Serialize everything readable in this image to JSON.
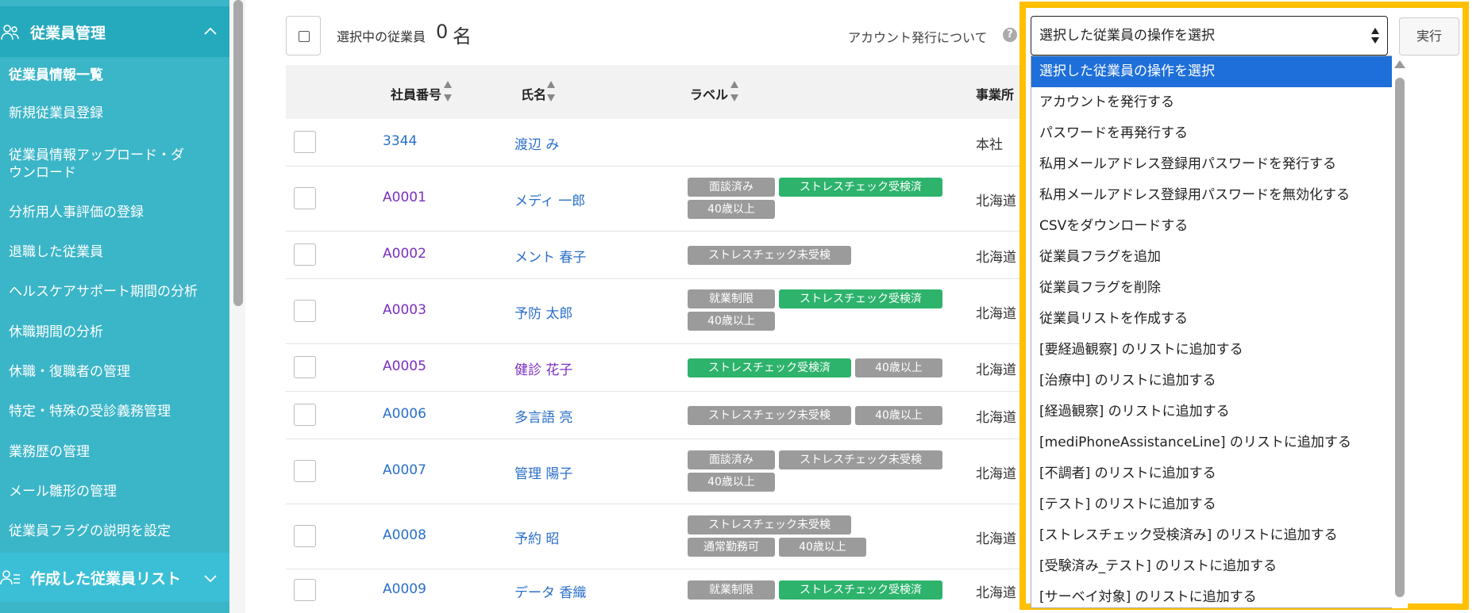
{
  "sidebar": {
    "section1": "従業員管理",
    "section2": "作成した従業員リスト",
    "items": [
      "従業員情報一覧",
      "新規従業員登録",
      "従業員情報アップロード・ダウンロード",
      "分析用人事評価の登録",
      "退職した従業員",
      "ヘルスケアサポート期間の分析",
      "休職期間の分析",
      "休職・復職者の管理",
      "特定・特殊の受診義務管理",
      "業務歴の管理",
      "メール雛形の管理",
      "従業員フラグの説明を設定"
    ]
  },
  "toolbar": {
    "selected_label": "選択中の従業員",
    "selected_count": "0",
    "selected_unit": "名",
    "account_link": "アカウント発行について",
    "help": "?",
    "operation_select": "選択した従業員の操作を選択",
    "run_button": "実行"
  },
  "table": {
    "columns": [
      "社員番号",
      "氏名",
      "ラベル",
      "事業所"
    ],
    "rows": [
      {
        "id": "3344",
        "name": "渡辺 み",
        "office": "本社"
      },
      {
        "id": "A0001",
        "name": "メディ 一郎",
        "office": "北海道"
      },
      {
        "id": "A0002",
        "name": "メント 春子",
        "office": "北海道"
      },
      {
        "id": "A0003",
        "name": "予防 太郎",
        "office": "北海道"
      },
      {
        "id": "A0005",
        "name": "健診 花子",
        "office": "北海道"
      },
      {
        "id": "A0006",
        "name": "多言語 亮",
        "office": "北海道"
      },
      {
        "id": "A0007",
        "name": "管理 陽子",
        "office": "北海道"
      },
      {
        "id": "A0008",
        "name": "予約 昭",
        "office": "北海道"
      },
      {
        "id": "A0009",
        "name": "データ 香織",
        "office": "北海道"
      }
    ],
    "labels": {
      "interviewed": "面談済み",
      "stress_done": "ストレスチェック受検済",
      "stress_not": "ストレスチェック未受検",
      "over40": "40歳以上",
      "work_limit": "就業制限",
      "normal_work": "通常勤務可"
    }
  },
  "dropdown": {
    "options": [
      "選択した従業員の操作を選択",
      "アカウントを発行する",
      "パスワードを再発行する",
      "私用メールアドレス登録用パスワードを発行する",
      "私用メールアドレス登録用パスワードを無効化する",
      "CSVをダウンロードする",
      "従業員フラグを追加",
      "従業員フラグを削除",
      "従業員リストを作成する",
      "[要経過観察] のリストに追加する",
      "[治療中] のリストに追加する",
      "[経過観察] のリストに追加する",
      "[mediPhoneAssistanceLine] のリストに追加する",
      "[不調者] のリストに追加する",
      "[テスト] のリストに追加する",
      "[ストレスチェック受検済み] のリストに追加する",
      "[受験済み_テスト] のリストに追加する",
      "[サーベイ対象] のリストに追加する"
    ]
  },
  "colors": {
    "sidebar": "#3bb5c8",
    "highlight_frame": "#ffc000",
    "badge_green": "#2db36c",
    "badge_gray": "#9b9b9b",
    "selected_option": "#1e6fd9"
  }
}
